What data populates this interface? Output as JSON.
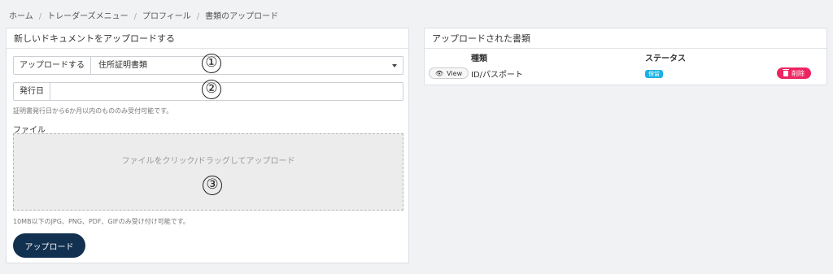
{
  "breadcrumb": [
    "ホーム",
    "トレーダーズメニュー",
    "プロフィール",
    "書類のアップロード"
  ],
  "upload_panel": {
    "title": "新しいドキュメントをアップロードする",
    "doc_type_label": "アップロードする",
    "doc_type_value": "住所証明書類",
    "issue_date_label": "発行日",
    "issue_date_value": "",
    "issue_date_help": "証明書発行日から6か月以内のもののみ受付可能です。",
    "file_label": "ファイル",
    "dropzone_text": "ファイルをクリック/ドラッグしてアップロード",
    "file_help": "10MB以下のJPG、PNG、PDF、GIFのみ受け付け可能です。",
    "upload_button": "アップロード"
  },
  "annotations": [
    "①",
    "②",
    "③"
  ],
  "uploaded_panel": {
    "title": "アップロードされた書類",
    "columns": [
      "",
      "種類",
      "ステータス",
      ""
    ],
    "rows": [
      {
        "view_label": "View",
        "type": "ID/パスポート",
        "status": "保留",
        "delete_label": "削除"
      }
    ]
  },
  "colors": {
    "primary_button": "#12304f",
    "status_badge": "#1ab1e4",
    "delete_button": "#ee2461"
  }
}
